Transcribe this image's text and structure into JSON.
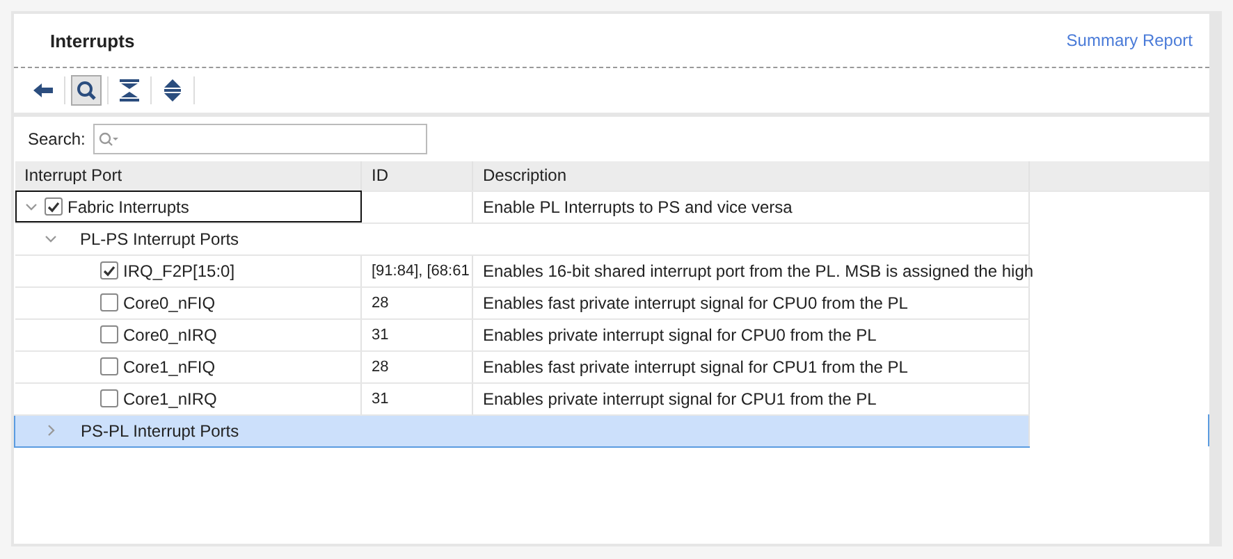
{
  "header": {
    "title": "Interrupts",
    "link": "Summary Report"
  },
  "toolbar": [
    {
      "kind": "back",
      "pressed": false
    },
    {
      "kind": "search",
      "pressed": true
    },
    {
      "kind": "collapse",
      "pressed": false
    },
    {
      "kind": "expand",
      "pressed": false
    }
  ],
  "search": {
    "label": "Search:"
  },
  "table": {
    "columns": [
      "Interrupt Port",
      "ID",
      "Description"
    ],
    "rows": [
      {
        "kind": "checkbox",
        "port": "Fabric Interrupts",
        "description": "Enable PL Interrupts to PS and vice versa",
        "checked": true,
        "expanded": true,
        "selected": false,
        "focused": true,
        "children": [
          {
            "kind": "group",
            "port": "PL-PS Interrupt Ports",
            "expanded": true,
            "selected": false,
            "children": [
              {
                "kind": "checkbox",
                "port": "IRQ_F2P[15:0]",
                "id": "[91:84], [68:61",
                "description": "Enables 16-bit shared interrupt port from the PL. MSB is assigned the high",
                "checked": true,
                "selected": false,
                "focused": false
              },
              {
                "kind": "checkbox",
                "port": "Core0_nFIQ",
                "id": "28",
                "description": "Enables fast private interrupt signal for CPU0 from the PL",
                "checked": false,
                "selected": false,
                "focused": false
              },
              {
                "kind": "checkbox",
                "port": "Core0_nIRQ",
                "id": "31",
                "description": "Enables private interrupt signal for CPU0 from the PL",
                "checked": false,
                "selected": false,
                "focused": false
              },
              {
                "kind": "checkbox",
                "port": "Core1_nFIQ",
                "id": "28",
                "description": "Enables fast private interrupt signal for CPU1 from the PL",
                "checked": false,
                "selected": false,
                "focused": false
              },
              {
                "kind": "checkbox",
                "port": "Core1_nIRQ",
                "id": "31",
                "description": "Enables private interrupt signal for CPU1 from the PL",
                "checked": false,
                "selected": false,
                "focused": false
              }
            ]
          },
          {
            "kind": "group",
            "port": "PS-PL Interrupt Ports",
            "expanded": false,
            "selected": true
          }
        ]
      }
    ]
  }
}
